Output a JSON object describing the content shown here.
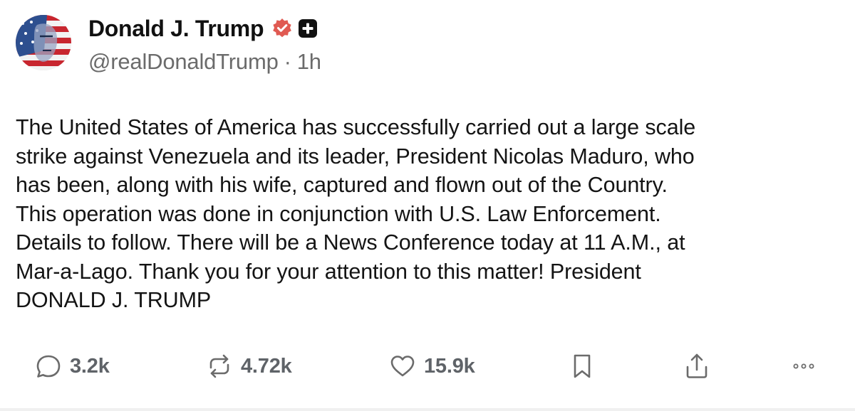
{
  "author": {
    "display_name": "Donald J. Trump",
    "handle": "@realDonaldTrump",
    "separator": "·",
    "time_ago": "1h",
    "verified_icon": "verified-badge-icon",
    "badge_icon": "plus-badge-icon"
  },
  "post": {
    "text": "The United States of America has successfully carried out a large scale\nstrike against Venezuela and its leader, President Nicolas Maduro, who\nhas been, along with his wife, captured and flown out of the Country.\nThis operation was done in conjunction with U.S. Law Enforcement.\nDetails to follow. There will be a News Conference today at 11 A.M., at\nMar-a-Lago. Thank you for your attention to this matter! President\nDONALD J. TRUMP"
  },
  "actions": {
    "replies": {
      "count": "3.2k",
      "icon": "reply-icon"
    },
    "reposts": {
      "count": "4.72k",
      "icon": "repost-icon"
    },
    "likes": {
      "count": "15.9k",
      "icon": "heart-icon"
    },
    "bookmark": {
      "icon": "bookmark-icon"
    },
    "share": {
      "icon": "share-icon"
    },
    "more": {
      "icon": "more-icon"
    }
  },
  "colors": {
    "verified": "#e05a52",
    "text": "#141414",
    "muted": "#6b6b6b",
    "action": "#5f6368"
  }
}
